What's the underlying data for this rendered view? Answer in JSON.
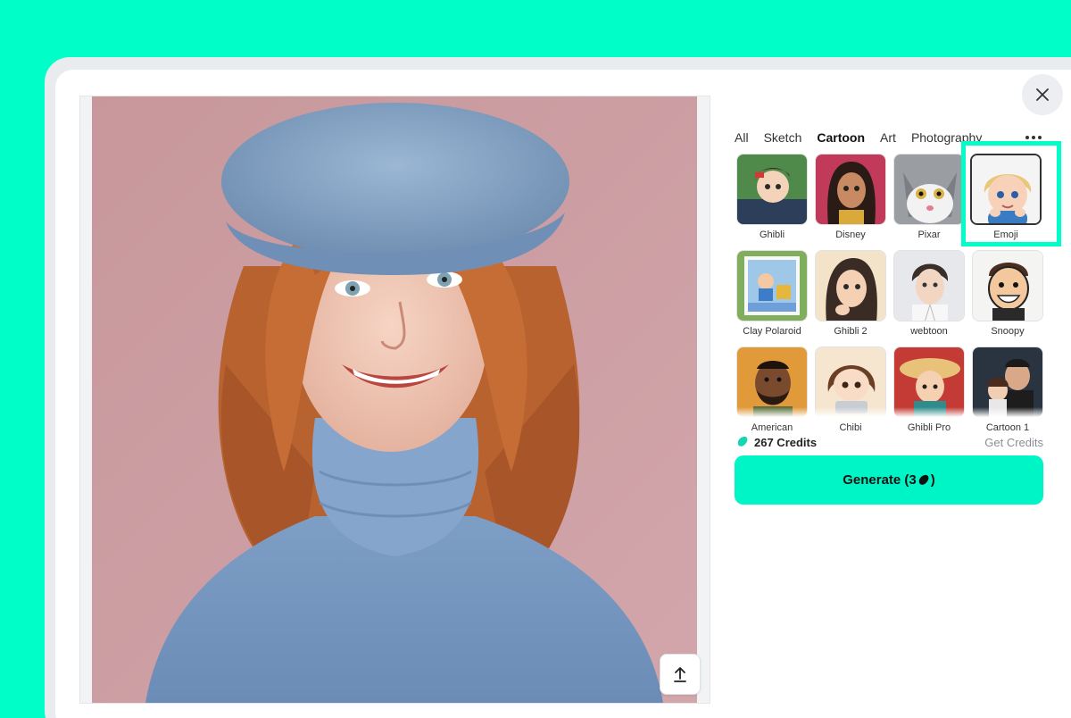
{
  "dialog": {
    "close_icon": "close-icon",
    "upload_icon": "upload-icon"
  },
  "tabs": [
    {
      "label": "All",
      "active": false
    },
    {
      "label": "Sketch",
      "active": false
    },
    {
      "label": "Cartoon",
      "active": true
    },
    {
      "label": "Art",
      "active": false
    },
    {
      "label": "Photography",
      "active": false
    }
  ],
  "more_icon": "more-horizontal-icon",
  "styles": [
    {
      "label": "Ghibli",
      "selected": false
    },
    {
      "label": "Disney",
      "selected": false
    },
    {
      "label": "Pixar",
      "selected": false
    },
    {
      "label": "Emoji",
      "selected": true
    },
    {
      "label": "Clay Polaroid",
      "selected": false
    },
    {
      "label": "Ghibli 2",
      "selected": false
    },
    {
      "label": "webtoon",
      "selected": false
    },
    {
      "label": "Snoopy",
      "selected": false
    },
    {
      "label": "American",
      "selected": false
    },
    {
      "label": "Chibi",
      "selected": false
    },
    {
      "label": "Ghibli Pro",
      "selected": false
    },
    {
      "label": "Cartoon 1",
      "selected": false
    }
  ],
  "credits": {
    "label": "267 Credits",
    "get_credits": "Get Credits",
    "icon": "bean-icon"
  },
  "generate": {
    "label_prefix": "Generate (3",
    "label_suffix": ")"
  },
  "colors": {
    "accent": "#00FFC8",
    "button": "#00F5C6"
  }
}
